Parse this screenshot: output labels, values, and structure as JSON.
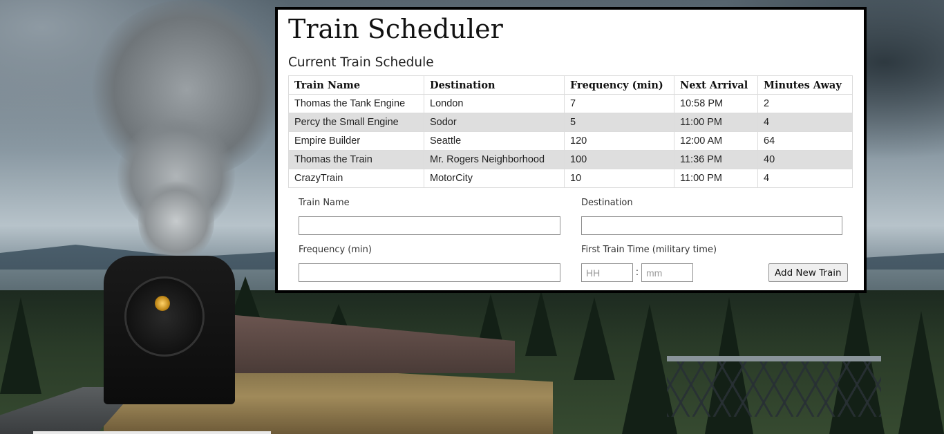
{
  "page": {
    "title": "Train Scheduler",
    "subtitle": "Current Train Schedule"
  },
  "table": {
    "headers": [
      "Train Name",
      "Destination",
      "Frequency (min)",
      "Next Arrival",
      "Minutes Away"
    ],
    "rows": [
      [
        "Thomas the Tank Engine",
        "London",
        "7",
        "10:58 PM",
        "2"
      ],
      [
        "Percy the Small Engine",
        "Sodor",
        "5",
        "11:00 PM",
        "4"
      ],
      [
        "Empire Builder",
        "Seattle",
        "120",
        "12:00 AM",
        "64"
      ],
      [
        "Thomas the Train",
        "Mr. Rogers Neighborhood",
        "100",
        "11:36 PM",
        "40"
      ],
      [
        "CrazyTrain",
        "MotorCity",
        "10",
        "11:00 PM",
        "4"
      ]
    ]
  },
  "form": {
    "train_name_label": "Train Name",
    "train_name_value": "",
    "destination_label": "Destination",
    "destination_value": "",
    "frequency_label": "Frequency (min)",
    "frequency_value": "",
    "first_time_label": "First Train Time (military time)",
    "hh_placeholder": "HH",
    "mm_placeholder": "mm",
    "separator": ":",
    "submit_label": "Add New Train"
  },
  "colors": {
    "panel_border": "#000000",
    "stripe": "#dedede"
  }
}
